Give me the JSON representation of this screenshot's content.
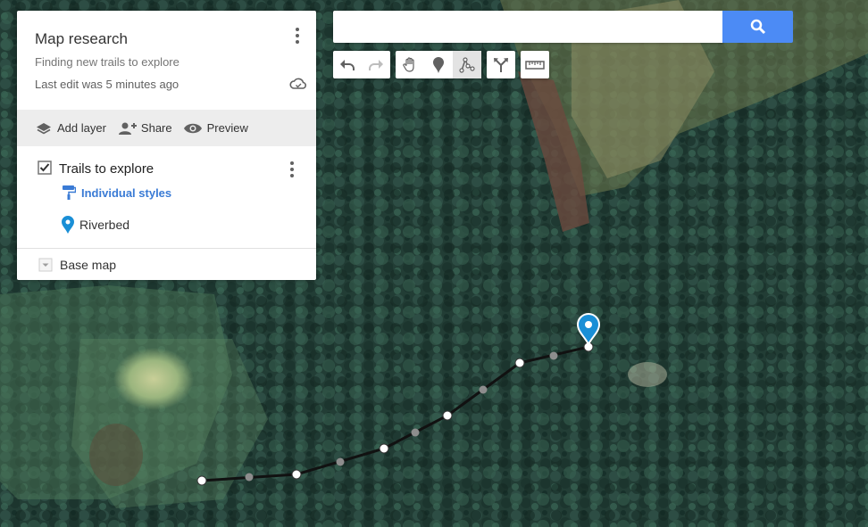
{
  "panel": {
    "title": "Map research",
    "description": "Finding new trails to explore",
    "last_edit": "Last edit was 5 minutes ago",
    "actions": {
      "add_layer": "Add layer",
      "share": "Share",
      "preview": "Preview"
    },
    "layer": {
      "title": "Trails to explore",
      "checked": true,
      "styles_label": "Individual styles",
      "feature_label": "Riverbed"
    },
    "base_map_label": "Base map"
  },
  "search": {
    "value": "",
    "placeholder": ""
  },
  "toolbar": {
    "history": [
      "undo-icon",
      "redo-icon"
    ],
    "tools": [
      "hand-icon",
      "add-marker-icon",
      "draw-line-icon"
    ],
    "active_tool": "draw-line-icon",
    "directions": "directions-icon",
    "measure": "ruler-icon"
  },
  "colors": {
    "accent": "#4c8bf5",
    "marker": "#1a8fd6",
    "link": "#3a7bd5",
    "trail": "#111111",
    "action_bar": "#ededed"
  },
  "map": {
    "type": "satellite",
    "marker_icon": "map-pin-icon",
    "trail_feature": "Riverbed"
  }
}
